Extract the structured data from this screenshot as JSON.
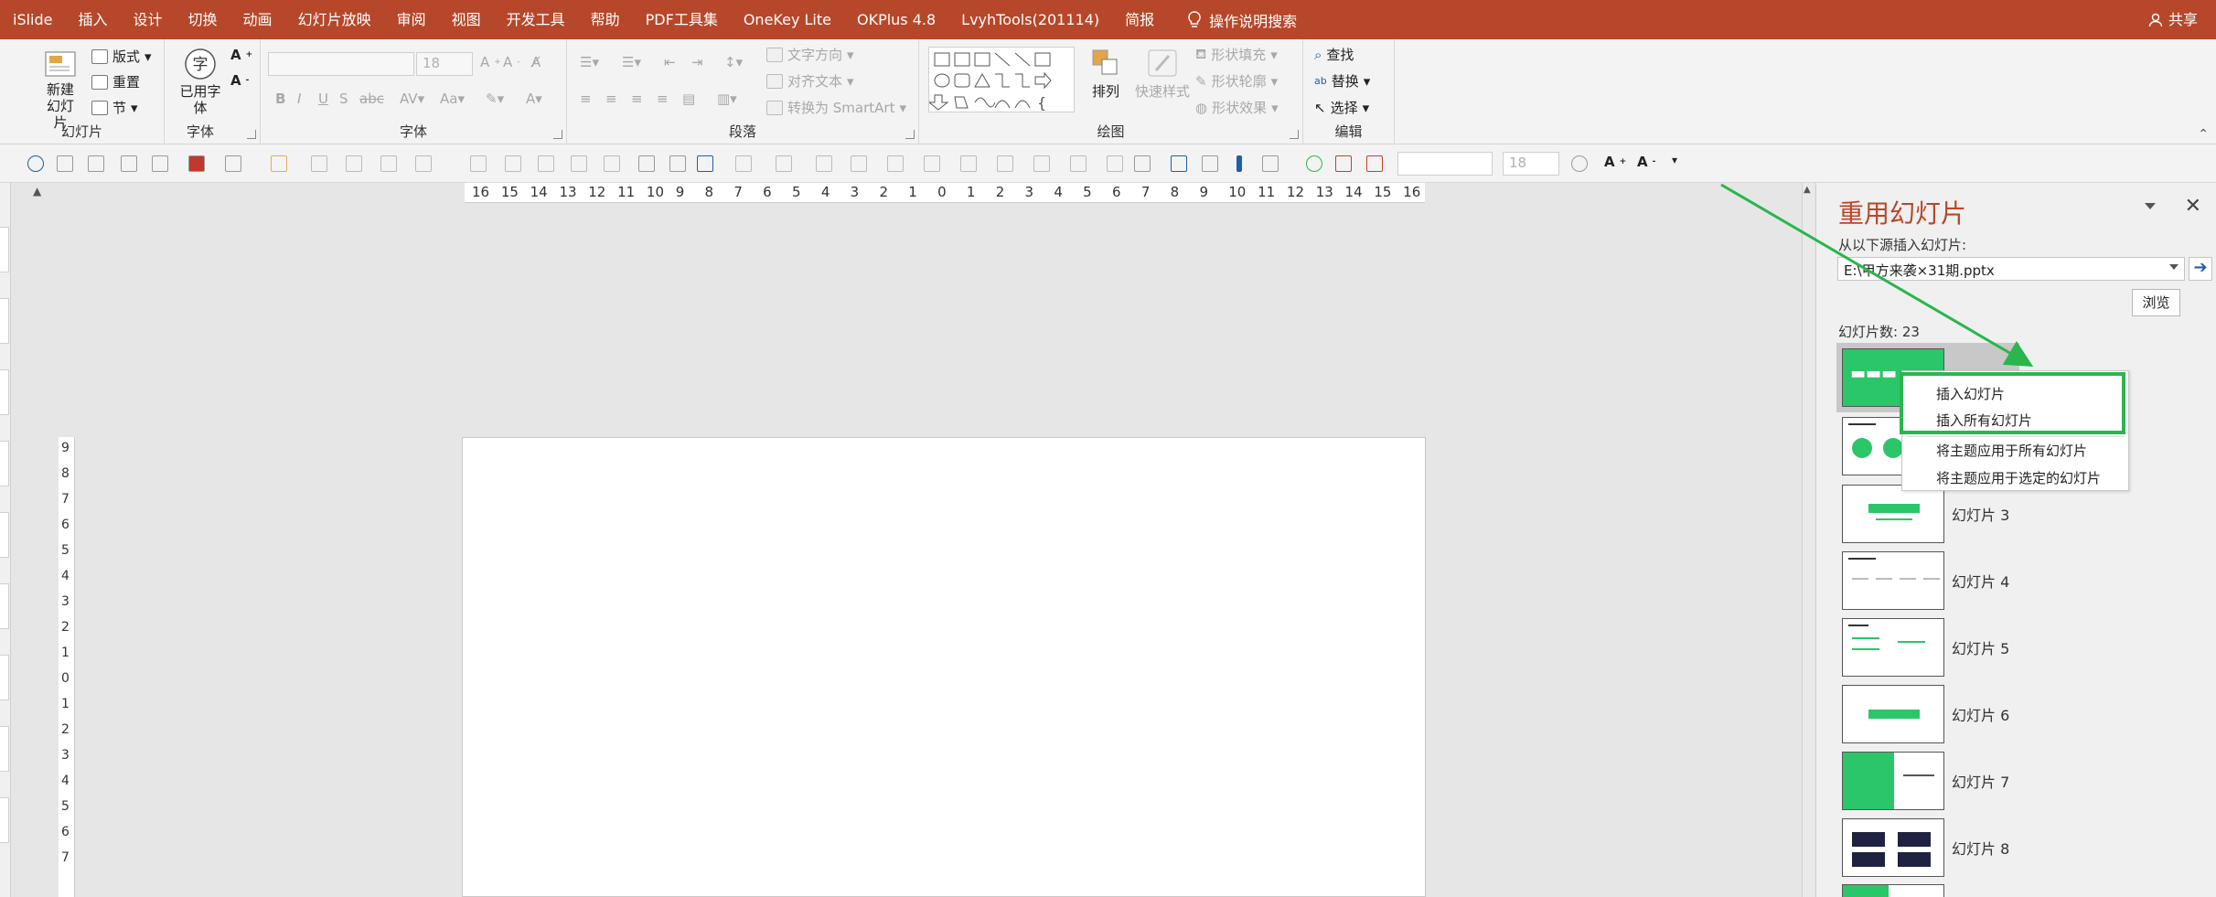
{
  "menu": {
    "items": [
      "iSlide",
      "插入",
      "设计",
      "切换",
      "动画",
      "幻灯片放映",
      "审阅",
      "视图",
      "开发工具",
      "帮助",
      "PDF工具集",
      "OneKey Lite",
      "OKPlus 4.8",
      "LvyhTools(201114)",
      "简报"
    ],
    "search": "操作说明搜索",
    "share": "共享"
  },
  "ribbon": {
    "slides": {
      "new_slide": "新建幻灯片",
      "layout": "版式",
      "reset": "重置",
      "section": "节",
      "label": "幻灯片"
    },
    "fonts": {
      "used_fonts": "已用字体",
      "label": "字体"
    },
    "font": {
      "size": "18",
      "label": "字体"
    },
    "paragraph": {
      "text_direction": "文字方向",
      "align_text": "对齐文本",
      "smartart": "转换为 SmartArt",
      "label": "段落"
    },
    "drawing": {
      "arrange": "排列",
      "quick_styles": "快速样式",
      "fill": "形状填充",
      "outline": "形状轮廓",
      "effects": "形状效果",
      "label": "绘图"
    },
    "editing": {
      "find": "查找",
      "replace": "替换",
      "select": "选择",
      "label": "编辑"
    }
  },
  "qat": {
    "size": "18"
  },
  "ruler": {
    "h": [
      "16",
      "15",
      "14",
      "13",
      "12",
      "11",
      "10",
      "9",
      "8",
      "7",
      "6",
      "5",
      "4",
      "3",
      "2",
      "1",
      "0",
      "1",
      "2",
      "3",
      "4",
      "5",
      "6",
      "7",
      "8",
      "9",
      "10",
      "11",
      "12",
      "13",
      "14",
      "15",
      "16"
    ],
    "v": [
      "9",
      "8",
      "7",
      "6",
      "5",
      "4",
      "3",
      "2",
      "1",
      "0",
      "1",
      "2",
      "3",
      "4",
      "5",
      "6",
      "7"
    ]
  },
  "pane": {
    "title": "重用幻灯片",
    "source_label": "从以下源插入幻灯片:",
    "path": "E:\\甲方来袭×31期.pptx",
    "browse": "浏览",
    "count": "幻灯片数: 23",
    "slides": [
      "幻灯片 3",
      "幻灯片 4",
      "幻灯片 5",
      "幻灯片 6",
      "幻灯片 7",
      "幻灯片 8"
    ]
  },
  "context_menu": {
    "items": [
      "插入幻灯片",
      "插入所有幻灯片",
      "将主题应用于所有幻灯片",
      "将主题应用于选定的幻灯片"
    ]
  },
  "colors": {
    "accent": "#b7472a",
    "highlight": "#2bb54e",
    "thumb_green": "#2bc66a"
  }
}
